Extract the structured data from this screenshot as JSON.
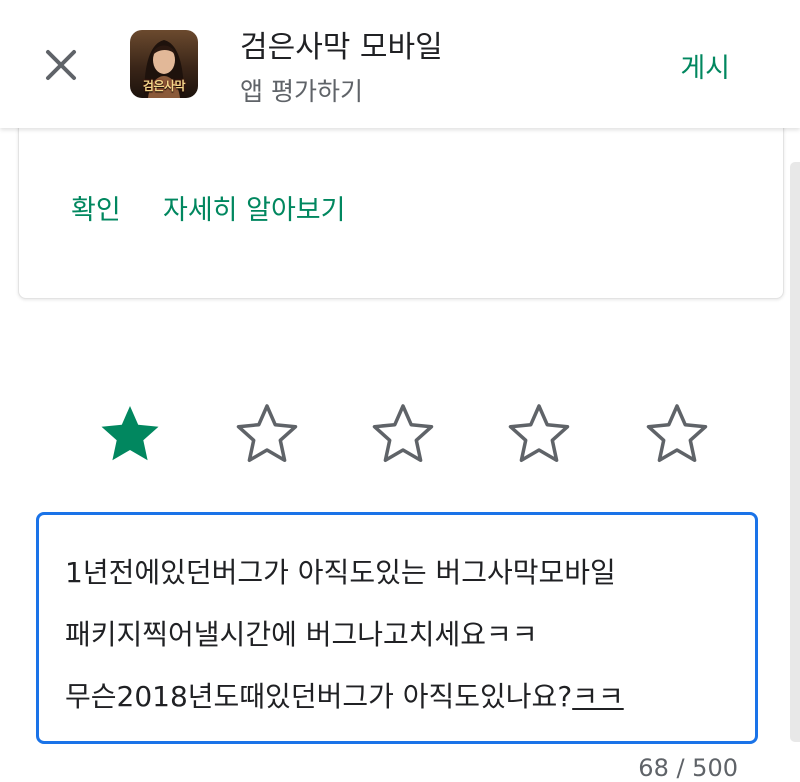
{
  "header": {
    "app_title": "검은사막 모바일",
    "subtitle": "앱 평가하기",
    "post_label": "게시",
    "icon_logo_text": "검은사막"
  },
  "notice": {
    "confirm_label": "확인",
    "learn_more_label": "자세히 알아보기"
  },
  "rating": {
    "value": 1,
    "max": 5,
    "filled_color": "#01875f",
    "empty_color": "#5f6368"
  },
  "review": {
    "line1": "1년전에있던버그가 아직도있는 버그사막모바일",
    "line2": "패키지찍어낼시간에 버그나고치세요ㅋㅋ",
    "line3_main": "무슨2018년도때있던버그가 아직도있나요?",
    "line3_composing": "ㅋㅋ",
    "char_count": "68 / 500"
  },
  "colors": {
    "accent": "#01875f",
    "focus_border": "#1a73e8"
  },
  "icons": {
    "close": "close-icon",
    "star_filled": "star-filled-icon",
    "star_empty": "star-outline-icon"
  }
}
